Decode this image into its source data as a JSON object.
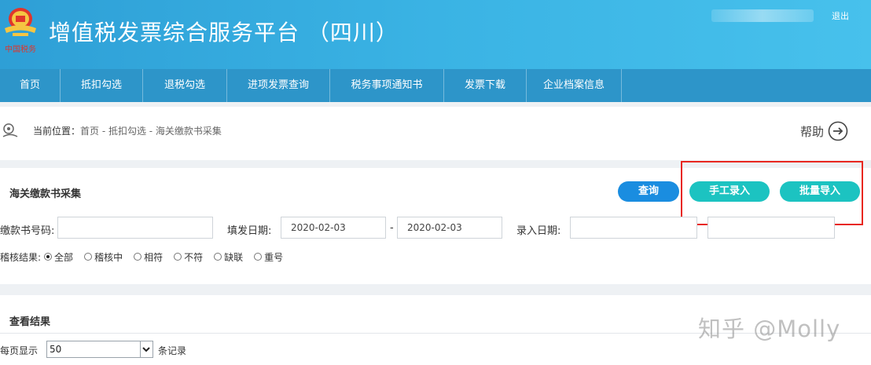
{
  "header": {
    "title": "增值税发票综合服务平台 （四川）",
    "emblem_text": "中国税务",
    "logout_label": "退出"
  },
  "nav": {
    "items": [
      {
        "label": "首页"
      },
      {
        "label": "抵扣勾选"
      },
      {
        "label": "退税勾选"
      },
      {
        "label": "进项发票查询"
      },
      {
        "label": "税务事项通知书"
      },
      {
        "label": "发票下载"
      },
      {
        "label": "企业档案信息"
      }
    ]
  },
  "breadcrumb": {
    "label": "当前位置：",
    "path": "首页 - 抵扣勾选 - 海关缴款书采集"
  },
  "help": {
    "label": "帮助"
  },
  "section": {
    "title": "海关缴款书采集",
    "buttons": {
      "query": "查询",
      "manual": "手工录入",
      "batch": "批量导入"
    }
  },
  "form": {
    "payment_no_label": "缴款书号码:",
    "payment_no_value": "",
    "issue_date_label": "填发日期:",
    "issue_date_from": "2020-02-03",
    "date_separator": "-",
    "issue_date_to": "2020-02-03",
    "entry_date_label": "录入日期:",
    "entry_date_from": "",
    "entry_date_to": "",
    "check_result_label": "稽核结果:",
    "check_result_options": [
      {
        "label": "全部",
        "selected": true
      },
      {
        "label": "稽核中",
        "selected": false
      },
      {
        "label": "相符",
        "selected": false
      },
      {
        "label": "不符",
        "selected": false
      },
      {
        "label": "缺联",
        "selected": false
      },
      {
        "label": "重号",
        "selected": false
      }
    ]
  },
  "results": {
    "title": "查看结果",
    "per_page_label": "每页显示",
    "per_page_value": "50",
    "records_label": "条记录"
  },
  "watermark": "知乎 @Molly",
  "colors": {
    "header_bg": "#3ab3e4",
    "nav_bg": "#2d95c9",
    "query_button": "#1a8de0",
    "action_button": "#1cc3c1",
    "highlight_box": "#e8271f"
  }
}
